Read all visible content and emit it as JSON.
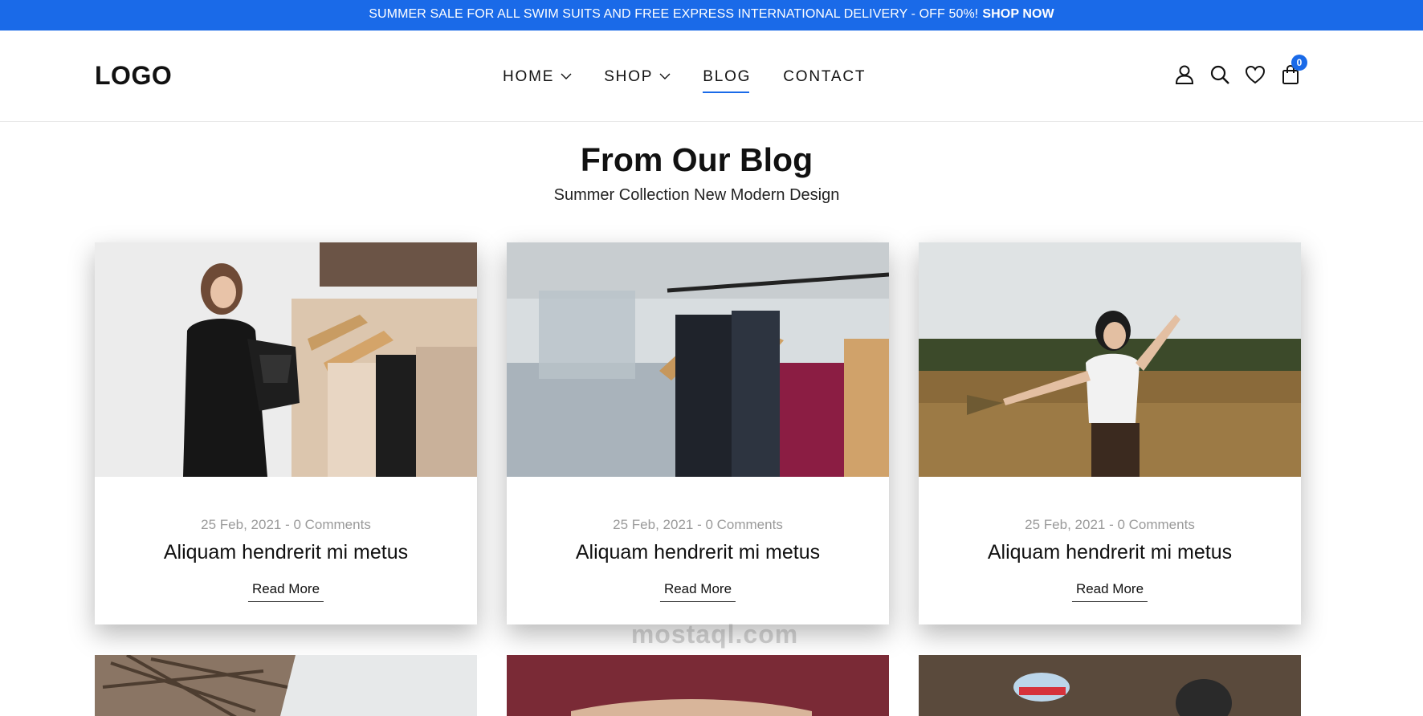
{
  "announcement": {
    "text": "SUMMER SALE FOR ALL SWIM SUITS AND FREE EXPRESS INTERNATIONAL DELIVERY - OFF 50%!",
    "cta": "SHOP NOW"
  },
  "header": {
    "logo": "LOGO",
    "nav": [
      {
        "label": "HOME",
        "has_dropdown": true
      },
      {
        "label": "SHOP",
        "has_dropdown": true
      },
      {
        "label": "BLOG",
        "active": true
      },
      {
        "label": "CONTACT"
      }
    ],
    "icons": [
      "user-icon",
      "search-icon",
      "heart-icon",
      "cart-icon"
    ],
    "cart_count": "0"
  },
  "blog": {
    "title": "From Our Blog",
    "subtitle": "Summer Collection New Modern Design",
    "posts": [
      {
        "meta": "25 Feb, 2021 - 0 Comments",
        "title": "Aliquam hendrerit mi metus",
        "cta": "Read More"
      },
      {
        "meta": "25 Feb, 2021 - 0 Comments",
        "title": "Aliquam hendrerit mi metus",
        "cta": "Read More"
      },
      {
        "meta": "25 Feb, 2021 - 0 Comments",
        "title": "Aliquam hendrerit mi metus",
        "cta": "Read More"
      }
    ]
  },
  "watermark": "mostaql.com",
  "colors": {
    "accent": "#1a6ae8",
    "text": "#111111",
    "muted": "#9a9a9a"
  }
}
